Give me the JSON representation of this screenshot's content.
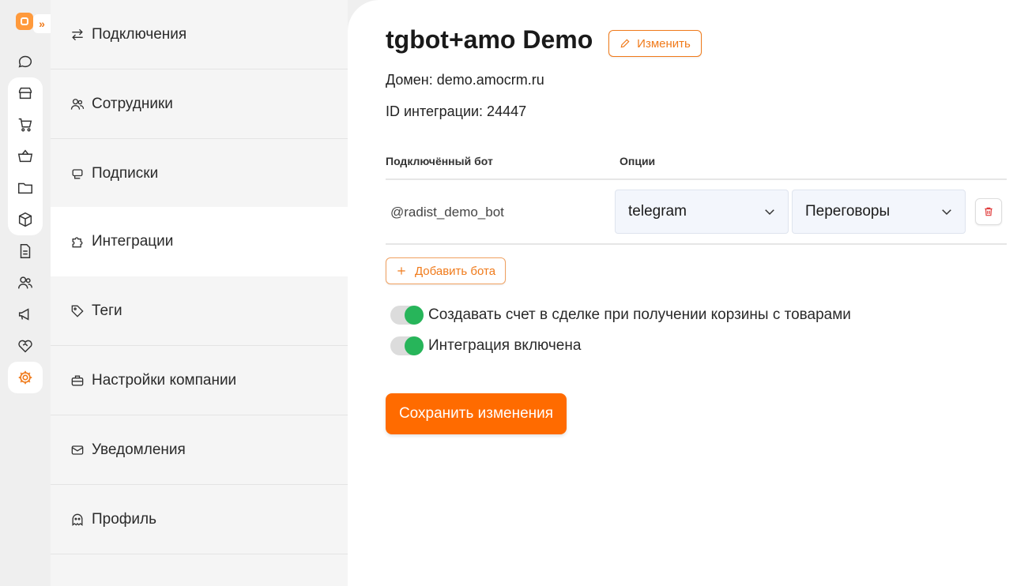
{
  "colors": {
    "accent": "#ff6b00",
    "toggle_on": "#27b55a"
  },
  "rail": {
    "expand_icon": "double-chevron-right-icon",
    "icons": [
      "chat-icon",
      "store-icon",
      "cart-icon",
      "basket-icon",
      "folder-icon",
      "box-icon",
      "document-icon",
      "users-icon",
      "megaphone-icon",
      "handshake-icon",
      "gear-icon"
    ]
  },
  "menu": {
    "items": [
      {
        "label": "Подключения",
        "icon": "arrows-swap-icon"
      },
      {
        "label": "Сотрудники",
        "icon": "users-icon"
      },
      {
        "label": "Подписки",
        "icon": "cards-icon"
      },
      {
        "label": "Интеграции",
        "icon": "puzzle-icon",
        "active": true
      },
      {
        "label": "Теги",
        "icon": "tag-icon"
      },
      {
        "label": "Настройки компании",
        "icon": "briefcase-icon"
      },
      {
        "label": "Уведомления",
        "icon": "mail-icon"
      },
      {
        "label": "Профиль",
        "icon": "ghost-icon"
      }
    ]
  },
  "integration": {
    "title": "tgbot+amo Demo",
    "edit_label": "Изменить",
    "domain": "Домен: demo.amocrm.ru",
    "integration_id": "ID интеграции: 24447"
  },
  "table": {
    "col_bot": "Подключённый бот",
    "col_options": "Опции",
    "rows": [
      {
        "bot": "@radist_demo_bot",
        "channel": "telegram",
        "pipeline": "Переговоры"
      }
    ]
  },
  "add_bot_label": "Добавить бота",
  "toggles": [
    {
      "label": "Создавать счет в сделке при получении корзины с товарами",
      "on": true
    },
    {
      "label": "Интеграция включена",
      "on": true
    }
  ],
  "save_label": "Сохранить изменения"
}
